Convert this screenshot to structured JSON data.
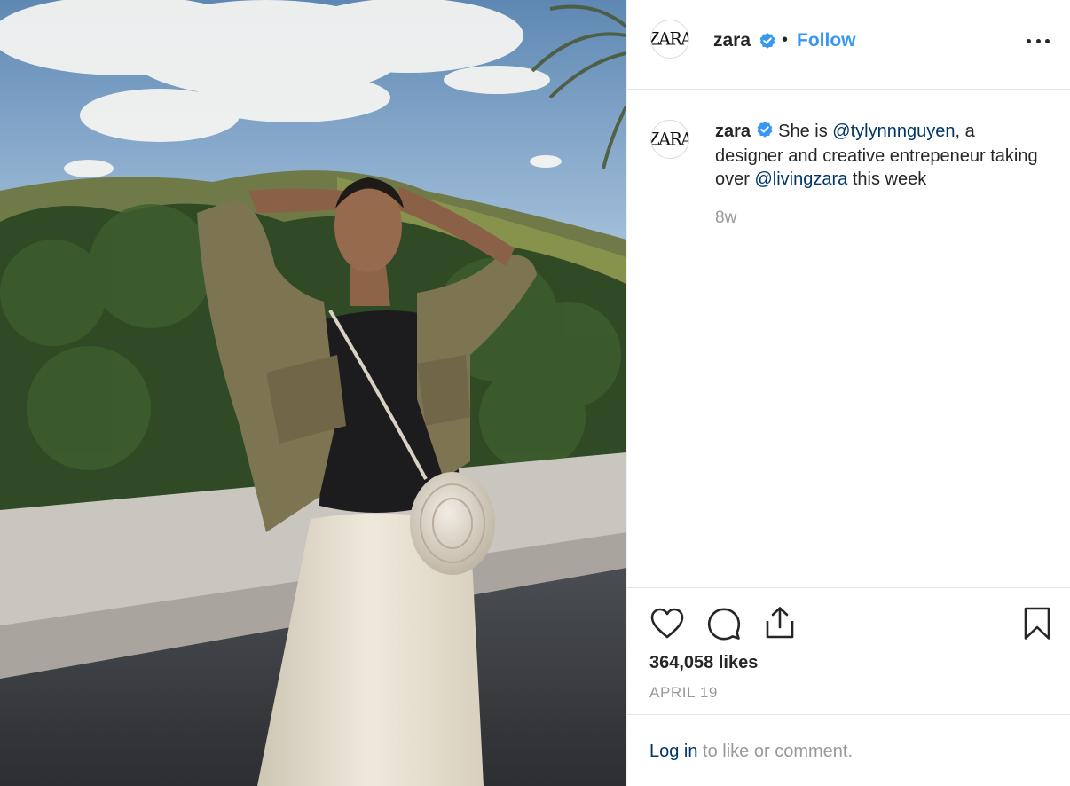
{
  "post": {
    "photo_alt": "Photo of woman in olive jacket and cream trousers with a round woven bag",
    "account": {
      "avatar_text": "ZARA",
      "username": "zara",
      "verified": true,
      "separator": "•",
      "follow_label": "Follow"
    },
    "caption": {
      "username": "zara",
      "part1": " She is ",
      "mention1": "@tylynnnguyen",
      "part2": ", a designer and creative entrepeneur taking over ",
      "mention2": "@livingzara",
      "part3": " this week",
      "age": "8w"
    },
    "likes": "364,058 likes",
    "date": "APRIL 19",
    "login": {
      "link": "Log in",
      "rest": " to like or comment."
    }
  },
  "colors": {
    "accent": "#3897f0",
    "link": "#003569",
    "muted": "#999999",
    "text": "#262626"
  },
  "icons": [
    "verified-badge-icon",
    "more-options-icon",
    "heart-icon",
    "comment-icon",
    "share-icon",
    "bookmark-icon"
  ]
}
